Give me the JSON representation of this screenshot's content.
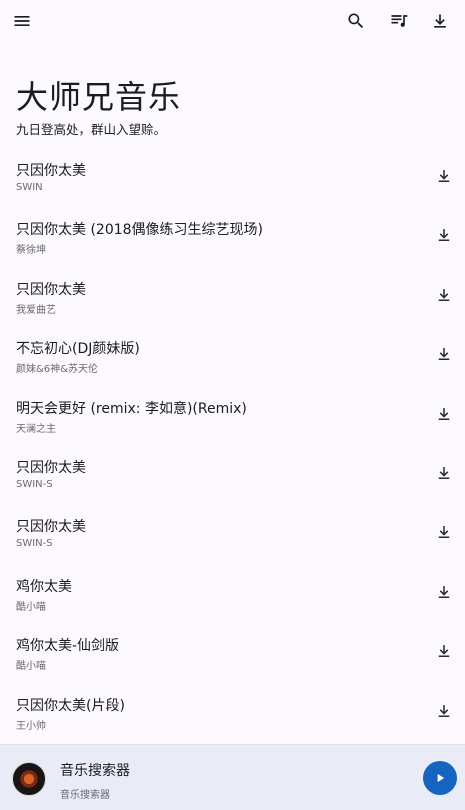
{
  "header": {
    "menu_icon": "menu-icon",
    "search_icon": "search-icon",
    "queue_icon": "queue-music-icon",
    "download_icon": "download-icon",
    "title": "大师兄音乐",
    "subtitle": "九日登高处，群山入望赊。"
  },
  "songs": [
    {
      "title": "只因你太美",
      "artist": "SWIN"
    },
    {
      "title": "只因你太美 (2018偶像练习生综艺现场)",
      "artist": "蔡徐坤"
    },
    {
      "title": "只因你太美",
      "artist": "我爱曲艺"
    },
    {
      "title": "不忘初心(DJ颜妹版)",
      "artist": "颜妹&6神&苏天伦"
    },
    {
      "title": "明天会更好 (remix: 李如意)(Remix)",
      "artist": "天澜之主"
    },
    {
      "title": "只因你太美",
      "artist": "SWIN-S"
    },
    {
      "title": "只因你太美",
      "artist": "SWIN-S"
    },
    {
      "title": "鸡你太美",
      "artist": "酷小喵"
    },
    {
      "title": "鸡你太美-仙剑版",
      "artist": "酷小喵"
    },
    {
      "title": "只因你太美(片段)",
      "artist": "王小帅"
    }
  ],
  "player": {
    "title": "音乐搜索器",
    "subtitle": "音乐搜索器",
    "play_icon": "play-icon"
  },
  "colors": {
    "background": "#fbf9fe",
    "player_background": "#e9ebf6",
    "accent": "#1565c0"
  }
}
